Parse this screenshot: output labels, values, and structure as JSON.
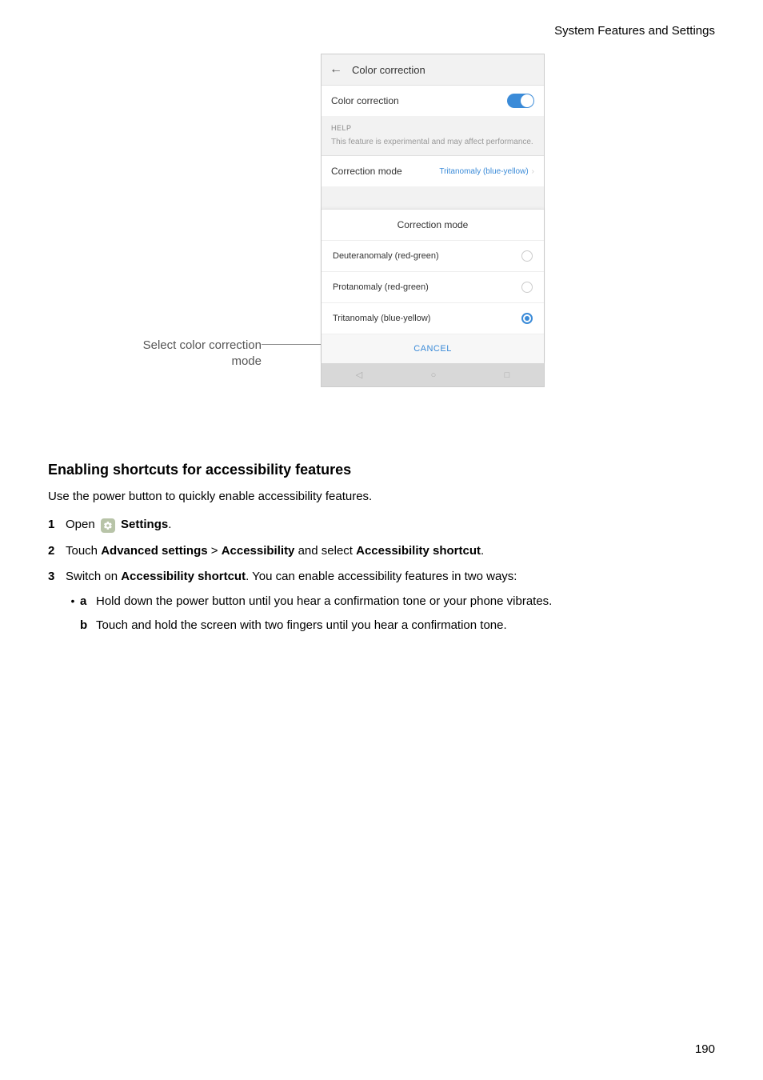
{
  "header": {
    "chapter": "System Features and Settings"
  },
  "figure": {
    "callout": "Select color correction mode",
    "phone": {
      "title": "Color correction",
      "toggle_label": "Color correction",
      "help_header": "HELP",
      "help_text": "This feature is experimental and may affect performance.",
      "mode_label": "Correction mode",
      "mode_value": "Tritanomaly (blue-yellow)"
    },
    "dialog": {
      "title": "Correction mode",
      "options": [
        {
          "label": "Deuteranomaly (red-green)",
          "selected": false
        },
        {
          "label": "Protanomaly (red-green)",
          "selected": false
        },
        {
          "label": "Tritanomaly (blue-yellow)",
          "selected": true
        }
      ],
      "cancel": "CANCEL"
    }
  },
  "section": {
    "heading": "Enabling shortcuts for accessibility features",
    "intro": "Use the power button to quickly enable accessibility features.",
    "steps": {
      "s1_a": "Open ",
      "s1_b": "Settings",
      "s1_c": ".",
      "s2_a": "Touch ",
      "s2_b": "Advanced settings",
      "s2_gt": " > ",
      "s2_c": "Accessibility",
      "s2_d": " and select ",
      "s2_e": "Accessibility shortcut",
      "s2_f": ".",
      "s3_a": "Switch on ",
      "s3_b": "Accessibility shortcut",
      "s3_c": ". You can enable accessibility features in two ways:",
      "s3_sub_a": "Hold down the power button until you hear a confirmation tone or your phone vibrates.",
      "s3_sub_b": "Touch and hold the screen with two fingers until you hear a confirmation tone."
    }
  },
  "page_number": "190"
}
